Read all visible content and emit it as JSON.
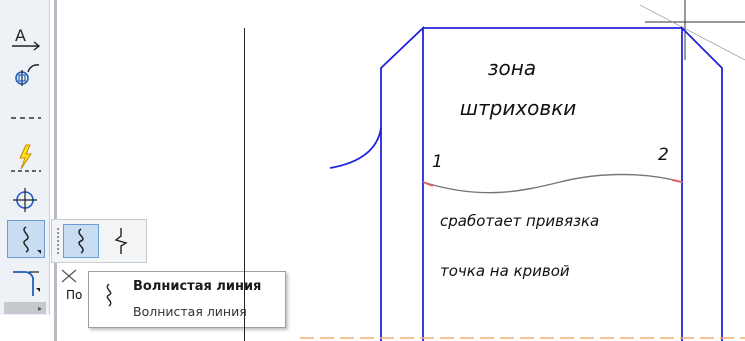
{
  "toolbar": {
    "buttons": [
      {
        "icon": "text-underline-icon",
        "glyph": "A"
      },
      {
        "icon": "hole-symbol-icon"
      },
      {
        "icon": "dashed-line-icon"
      },
      {
        "icon": "lightning-line-icon"
      },
      {
        "icon": "center-mark-icon"
      },
      {
        "icon": "wavy-line-icon",
        "selected": true
      },
      {
        "icon": "corner-arc-icon"
      }
    ],
    "scroll_arrow": "▸"
  },
  "flyout": {
    "items": [
      {
        "icon": "wavy-line-icon",
        "selected": true
      },
      {
        "icon": "break-line-icon",
        "selected": false
      }
    ]
  },
  "partial_label": "По",
  "tooltip": {
    "icon": "wavy-line-icon",
    "title": "Волнистая линия",
    "description": "Волнистая линия"
  },
  "drawing": {
    "zone_line1": "зона",
    "zone_line2": "штриховки",
    "point1": "1",
    "point2": "2",
    "note_line1": "сработает привязка",
    "note_line2": "точка на кривой",
    "colors": {
      "contour": "#2323dd",
      "wavy": "#777777",
      "endpoint": "#e06666",
      "bottom_dashed": "#f0b070",
      "text": "#111111"
    }
  }
}
